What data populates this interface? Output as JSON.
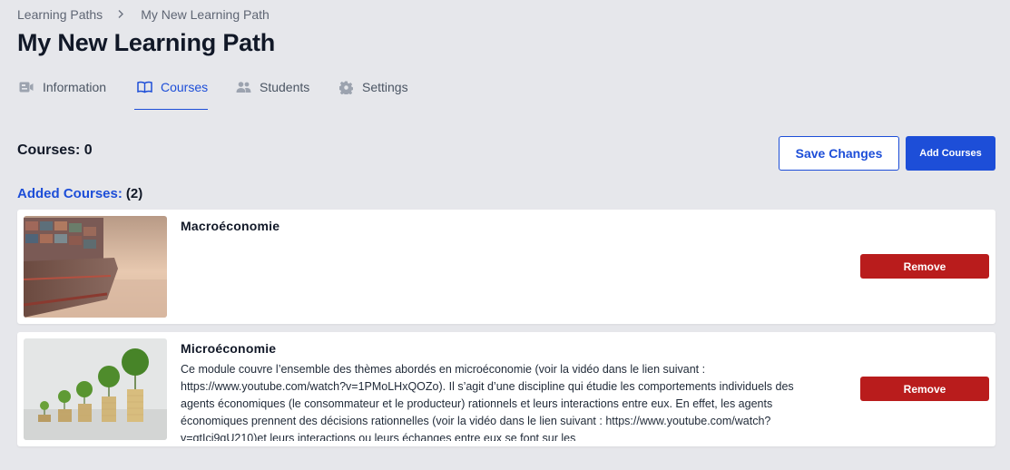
{
  "breadcrumb": {
    "root": "Learning Paths",
    "separator": ">",
    "current": "My New Learning Path"
  },
  "page_title": "My New Learning Path",
  "tabs": [
    {
      "label": "Information",
      "icon": "id-card-icon",
      "active": false
    },
    {
      "label": "Courses",
      "icon": "book-open-icon",
      "active": true
    },
    {
      "label": "Students",
      "icon": "users-icon",
      "active": false
    },
    {
      "label": "Settings",
      "icon": "gear-icon",
      "active": false
    }
  ],
  "courses_summary": "Courses: 0",
  "buttons": {
    "save": "Save Changes",
    "add": "Add Courses"
  },
  "added": {
    "label": "Added Courses:",
    "count": "(2)"
  },
  "course_list": [
    {
      "title": "Macroéconomie",
      "description": "",
      "thumbnail": "cargo-ship-image",
      "remove_label": "Remove"
    },
    {
      "title": "Microéconomie",
      "description": "Ce module couvre l’ensemble des thèmes abordés en microéconomie (voir la vidéo dans le lien suivant : https://www.youtube.com/watch?v=1PMoLHxQOZo). Il s’agit d’une discipline qui étudie les comportements individuels des agents économiques (le consommateur et le producteur) rationnels et leurs interactions entre eux. En effet, les agents économiques prennent des décisions rationnelles (voir la vidéo dans le lien suivant : https://www.youtube.com/watch?v=gtIci9gU210)et leurs interactions ou leurs échanges entre eux se font sur les",
      "thumbnail": "growing-coins-plants-image",
      "remove_label": "Remove"
    }
  ],
  "colors": {
    "accent": "#1d4ed8",
    "danger": "#b91c1c",
    "background": "#e6e7eb"
  }
}
